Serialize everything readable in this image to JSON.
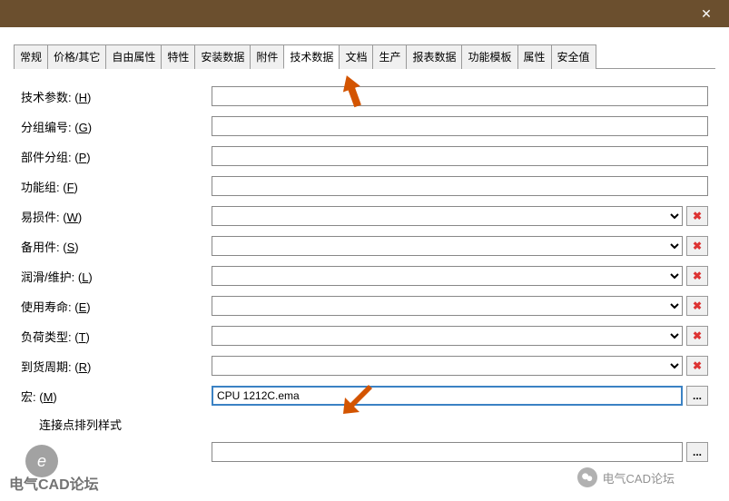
{
  "titlebar": {
    "close": "✕"
  },
  "tabs": [
    "常规",
    "价格/其它",
    "自由属性",
    "特性",
    "安装数据",
    "附件",
    "技术数据",
    "文档",
    "生产",
    "报表数据",
    "功能模板",
    "属性",
    "安全值"
  ],
  "active_tab_index": 6,
  "fields": {
    "tech_param": {
      "label": "技术参数:",
      "hotkey": "H",
      "value": ""
    },
    "group_num": {
      "label": "分组编号:",
      "hotkey": "G",
      "value": ""
    },
    "part_group": {
      "label": "部件分组:",
      "hotkey": "P",
      "value": ""
    },
    "func_group": {
      "label": "功能组:",
      "hotkey": "F",
      "value": ""
    },
    "wear_part": {
      "label": "易损件:",
      "hotkey": "W",
      "value": ""
    },
    "spare_part": {
      "label": "备用件:",
      "hotkey": "S",
      "value": ""
    },
    "lubricate": {
      "label": "润滑/维护:",
      "hotkey": "L",
      "value": ""
    },
    "lifetime": {
      "label": "使用寿命:",
      "hotkey": "E",
      "value": ""
    },
    "load_type": {
      "label": "负荷类型:",
      "hotkey": "T",
      "value": ""
    },
    "delivery": {
      "label": "到货周期:",
      "hotkey": "R",
      "value": ""
    },
    "macro": {
      "label": "宏:",
      "hotkey": "M",
      "value": "CPU 1212C.ema"
    },
    "conn_style": {
      "label": "连接点排列样式"
    }
  },
  "buttons": {
    "delete": "✖",
    "browse": "..."
  },
  "watermark": {
    "forum": "电气CAD论坛",
    "wechat": "电气CAD论坛",
    "circle": "e"
  }
}
